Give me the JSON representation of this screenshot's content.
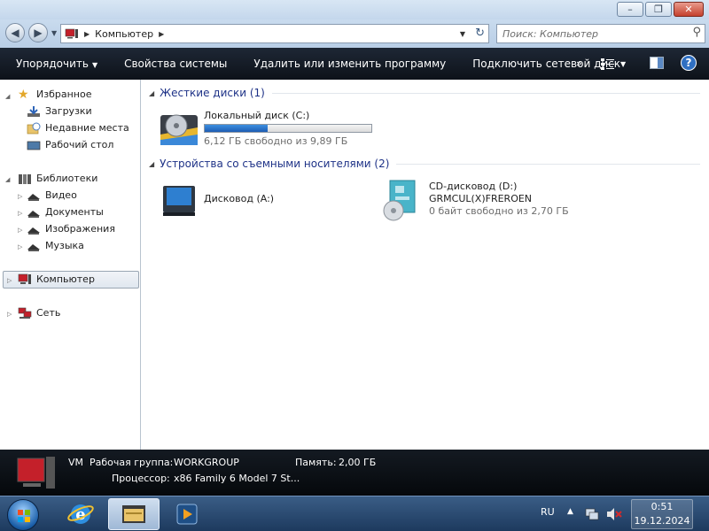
{
  "window": {
    "controls": {
      "minimize": "–",
      "maximize": "❐",
      "close": "✕"
    }
  },
  "address": {
    "path": "Компьютер",
    "search_placeholder": "Поиск: Компьютер"
  },
  "toolbar": {
    "organize": "Упорядочить",
    "system_properties": "Свойства системы",
    "uninstall": "Удалить или изменить программу",
    "map_drive": "Подключить сетевой диск",
    "more": "»",
    "help": "?"
  },
  "sidebar": {
    "favorites": {
      "label": "Избранное",
      "items": [
        "Загрузки",
        "Недавние места",
        "Рабочий стол"
      ]
    },
    "libraries": {
      "label": "Библиотеки",
      "items": [
        "Видео",
        "Документы",
        "Изображения",
        "Музыка"
      ]
    },
    "computer": "Компьютер",
    "network": "Сеть"
  },
  "content": {
    "hard_drives_header": "Жесткие диски (1)",
    "removable_header": "Устройства со съемными носителями (2)",
    "local_disk": {
      "name": "Локальный диск (C:)",
      "free_text": "6,12 ГБ свободно из 9,89 ГБ",
      "used_fraction": 0.38
    },
    "floppy": {
      "name": "Дисковод (A:)"
    },
    "cd_drive": {
      "name": "CD-дисковод (D:)",
      "label": "GRMCUL(X)FREROEN",
      "free_text": "0 байт свободно из 2,70 ГБ"
    }
  },
  "details": {
    "computer_name": "VM",
    "workgroup_label": "Рабочая группа:",
    "workgroup_value": "WORKGROUP",
    "memory_label": "Память:",
    "memory_value": "2,00 ГБ",
    "cpu_label": "Процессор:",
    "cpu_value": "x86 Family 6 Model 7 St..."
  },
  "taskbar": {
    "language": "RU",
    "time": "0:51",
    "date": "19.12.2024"
  },
  "colors": {
    "accent": "#1e3287",
    "command_bar": "#141b26",
    "taskbar": "#2a4a72"
  }
}
